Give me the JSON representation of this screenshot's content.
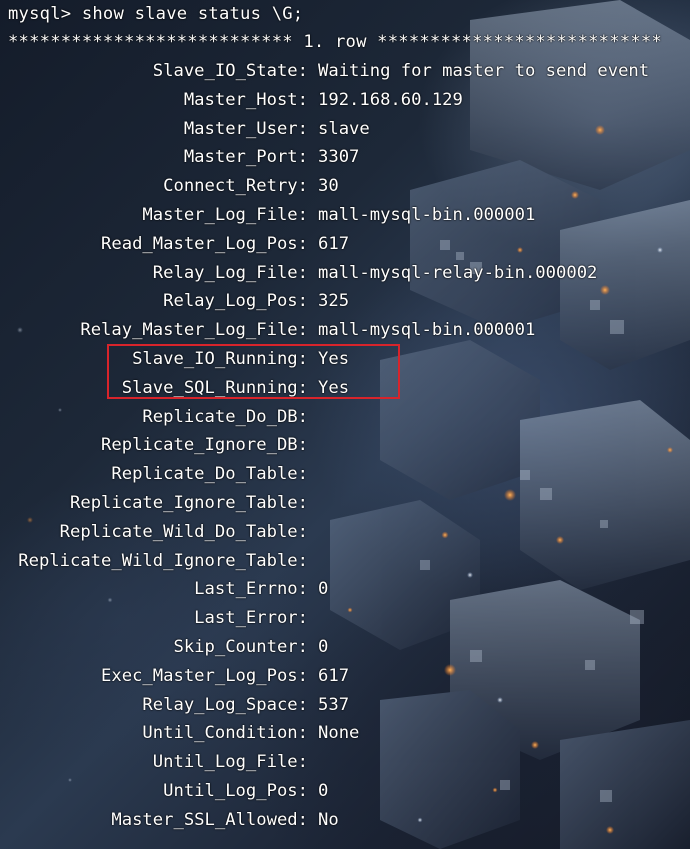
{
  "terminal": {
    "prompt": "mysql> show slave status \\G;",
    "row_header": "*************************** 1. row ***************************",
    "highlight_color": "#d8242b",
    "text_color": "#ffffff",
    "fields": [
      {
        "name": "Slave_IO_State:",
        "value": "Waiting for master to send event"
      },
      {
        "name": "Master_Host:",
        "value": "192.168.60.129"
      },
      {
        "name": "Master_User:",
        "value": "slave"
      },
      {
        "name": "Master_Port:",
        "value": "3307"
      },
      {
        "name": "Connect_Retry:",
        "value": "30"
      },
      {
        "name": "Master_Log_File:",
        "value": "mall-mysql-bin.000001"
      },
      {
        "name": "Read_Master_Log_Pos:",
        "value": "617"
      },
      {
        "name": "Relay_Log_File:",
        "value": "mall-mysql-relay-bin.000002"
      },
      {
        "name": "Relay_Log_Pos:",
        "value": "325"
      },
      {
        "name": "Relay_Master_Log_File:",
        "value": "mall-mysql-bin.000001"
      },
      {
        "name": "Slave_IO_Running:",
        "value": "Yes"
      },
      {
        "name": "Slave_SQL_Running:",
        "value": "Yes"
      },
      {
        "name": "Replicate_Do_DB:",
        "value": ""
      },
      {
        "name": "Replicate_Ignore_DB:",
        "value": ""
      },
      {
        "name": "Replicate_Do_Table:",
        "value": ""
      },
      {
        "name": "Replicate_Ignore_Table:",
        "value": ""
      },
      {
        "name": "Replicate_Wild_Do_Table:",
        "value": ""
      },
      {
        "name": "Replicate_Wild_Ignore_Table:",
        "value": ""
      },
      {
        "name": "Last_Errno:",
        "value": "0"
      },
      {
        "name": "Last_Error:",
        "value": ""
      },
      {
        "name": "Skip_Counter:",
        "value": "0"
      },
      {
        "name": "Exec_Master_Log_Pos:",
        "value": "617"
      },
      {
        "name": "Relay_Log_Space:",
        "value": "537"
      },
      {
        "name": "Until_Condition:",
        "value": "None"
      },
      {
        "name": "Until_Log_File:",
        "value": ""
      },
      {
        "name": "Until_Log_Pos:",
        "value": "0"
      },
      {
        "name": "Master_SSL_Allowed:",
        "value": "No"
      }
    ]
  }
}
